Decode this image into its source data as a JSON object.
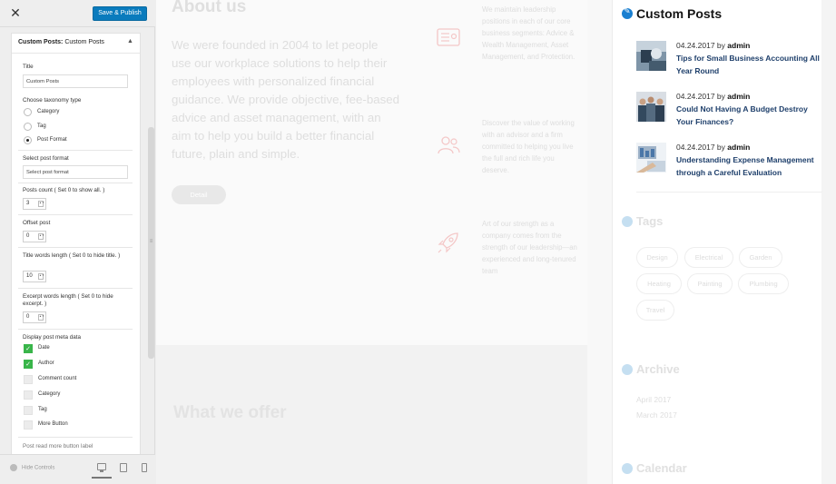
{
  "customizer": {
    "close_icon": "close-icon",
    "save_label": "Save & Publish",
    "section_prefix": "Custom Posts:",
    "section_title": "Custom Posts",
    "title_label": "Title",
    "title_value": "Custom Posts",
    "taxonomy_label": "Choose taxonomy type",
    "taxonomy_options": [
      "Category",
      "Tag",
      "Post Format"
    ],
    "taxonomy_selected": "Post Format",
    "post_format_label": "Select post format",
    "post_format_placeholder": "Select post format",
    "posts_count_label": "Posts count ( Set 0 to show all. )",
    "posts_count_value": "3",
    "offset_label": "Offset post",
    "offset_value": "0",
    "title_words_label": "Title words length ( Set 0 to hide title. )",
    "title_words_value": "10",
    "excerpt_words_label": "Excerpt words length ( Set 0 to hide excerpt. )",
    "excerpt_words_value": "0",
    "meta_label": "Display post meta data",
    "meta_options": [
      {
        "label": "Date",
        "checked": true
      },
      {
        "label": "Author",
        "checked": true
      },
      {
        "label": "Comment count",
        "checked": false
      },
      {
        "label": "Category",
        "checked": false
      },
      {
        "label": "Tag",
        "checked": false
      },
      {
        "label": "More Button",
        "checked": false
      }
    ],
    "read_more_label": "Post read more button label",
    "hide_controls": "Hide Controls",
    "accent": "#0a7bbd",
    "check_color": "#39b54a"
  },
  "preview": {
    "about_title": "About us",
    "about_body": "We were founded in 2004 to let people use our workplace solutions to help their employees with personalized financial guidance. We provide objective, fee-based advice and asset management, with an aim to help you build a better financial future, plain and simple.",
    "detail_label": "Detail",
    "features": [
      {
        "icon": "document-list-icon",
        "text": "We maintain leadership positions in each of our core business segments: Advice & Wealth Management, Asset Management, and Protection."
      },
      {
        "icon": "people-icon",
        "text": "Discover the value of working with an advisor and a firm committed to helping you live the full and rich life you deserve."
      },
      {
        "icon": "rocket-icon",
        "text": "Art of our strength as a company comes from the strength of our leadership—an experienced and long-tenured team"
      }
    ],
    "offer_title": "What we offer"
  },
  "sidebar": {
    "custom_posts_title": "Custom Posts",
    "posts": [
      {
        "date": "04.24.2017",
        "by": "by",
        "author": "admin",
        "title": "Tips for Small Business Accounting All Year Round"
      },
      {
        "date": "04.24.2017",
        "by": "by",
        "author": "admin",
        "title": "Could Not Having A Budget Destroy Your Finances?"
      },
      {
        "date": "04.24.2017",
        "by": "by",
        "author": "admin",
        "title": "Understanding Expense Management through a Careful Evaluation"
      }
    ],
    "tags_title": "Tags",
    "tags": [
      "Design",
      "Electrical",
      "Garden",
      "Heating",
      "Painting",
      "Plumbing",
      "Travel"
    ],
    "archive_title": "Archive",
    "archive": [
      "April 2017",
      "March 2017"
    ],
    "calendar_title": "Calendar",
    "link_color": "#1e3f6b",
    "icon_color": "#1a7fd0"
  }
}
